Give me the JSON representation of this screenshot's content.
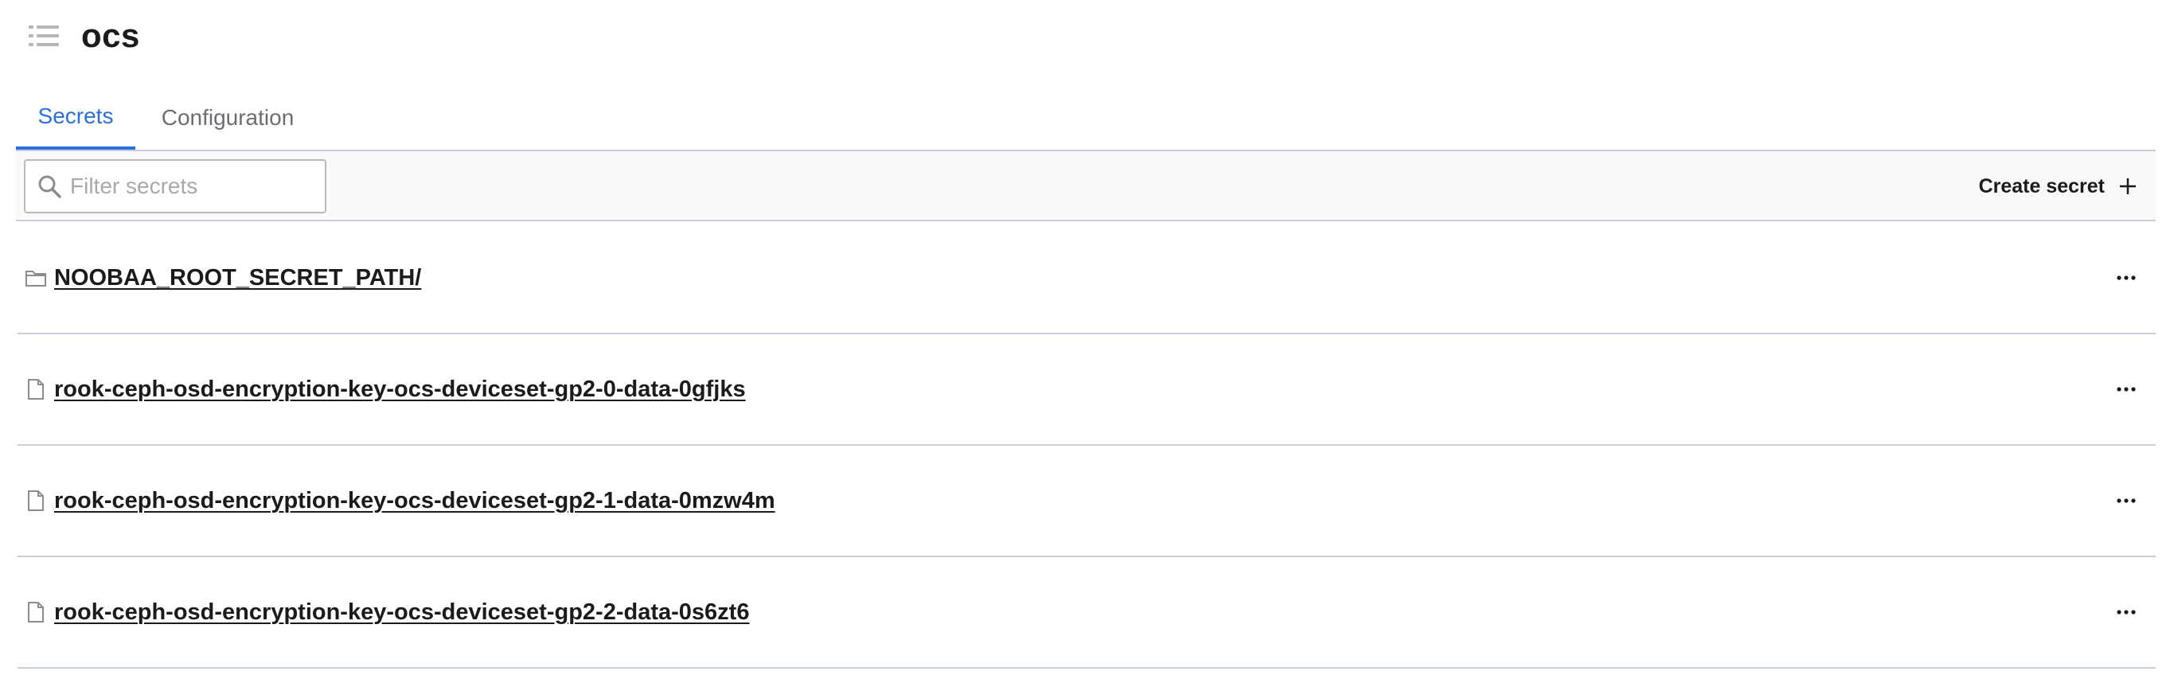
{
  "header": {
    "title": "ocs",
    "menu_icon": "list-icon"
  },
  "tabs": [
    {
      "label": "Secrets",
      "active": true
    },
    {
      "label": "Configuration",
      "active": false
    }
  ],
  "toolbar": {
    "search_placeholder": "Filter secrets",
    "search_value": "",
    "create_label": "Create secret"
  },
  "secrets": [
    {
      "name": "NOOBAA_ROOT_SECRET_PATH/",
      "type": "folder",
      "icon": "folder-icon"
    },
    {
      "name": "rook-ceph-osd-encryption-key-ocs-deviceset-gp2-0-data-0gfjks",
      "type": "secret",
      "icon": "file-icon"
    },
    {
      "name": "rook-ceph-osd-encryption-key-ocs-deviceset-gp2-1-data-0mzw4m",
      "type": "secret",
      "icon": "file-icon"
    },
    {
      "name": "rook-ceph-osd-encryption-key-ocs-deviceset-gp2-2-data-0s6zt6",
      "type": "secret",
      "icon": "file-icon"
    }
  ],
  "colors": {
    "accent": "#2b6fde",
    "border": "#c9cede",
    "text": "#1b1b1b",
    "muted": "#6a6e73"
  }
}
